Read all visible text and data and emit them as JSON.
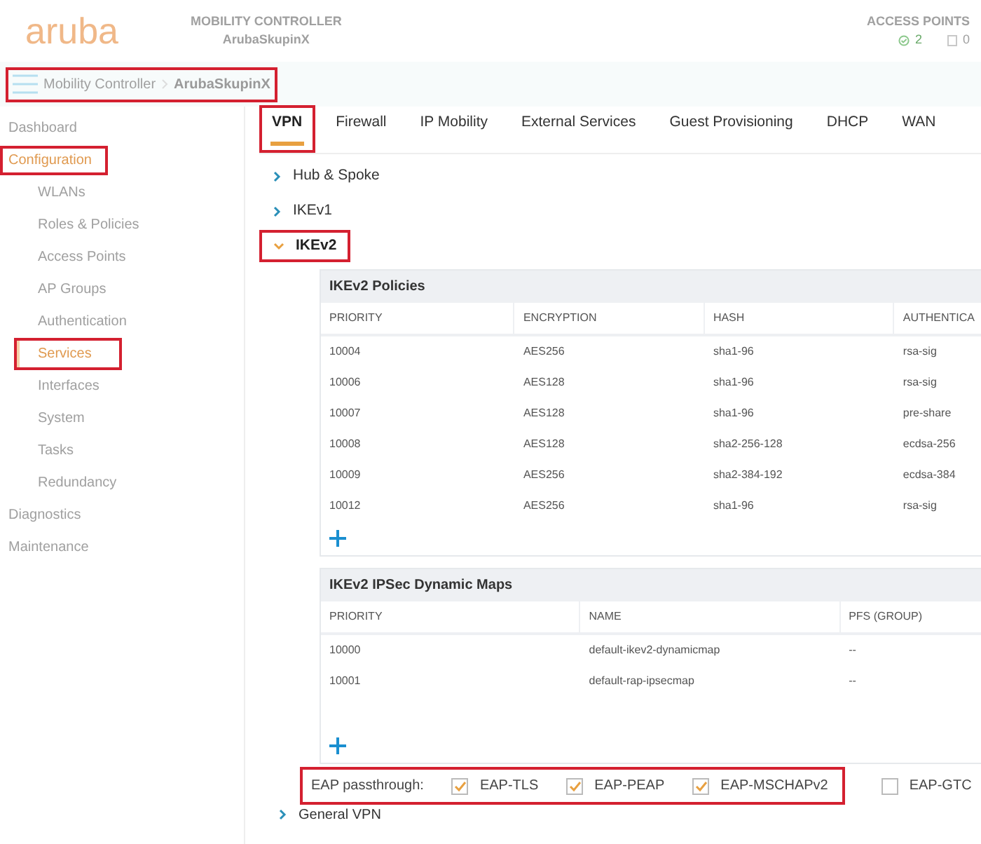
{
  "header": {
    "logo": "aruba",
    "controller_label": "MOBILITY CONTROLLER",
    "controller_name": "ArubaSkupinX",
    "access_points_label": "ACCESS POINTS",
    "ap_up": "2",
    "ap_down": "0"
  },
  "breadcrumb": {
    "items": [
      "Mobility Controller",
      "ArubaSkupinX"
    ],
    "annotated": true
  },
  "sidebar": {
    "items": [
      {
        "label": "Dashboard",
        "selected": false,
        "annotated": false
      },
      {
        "label": "Configuration",
        "selected": true,
        "annotated": true,
        "children": [
          {
            "label": "WLANs",
            "selected": false,
            "annotated": false
          },
          {
            "label": "Roles & Policies",
            "selected": false,
            "annotated": false
          },
          {
            "label": "Access Points",
            "selected": false,
            "annotated": false
          },
          {
            "label": "AP Groups",
            "selected": false,
            "annotated": false
          },
          {
            "label": "Authentication",
            "selected": false,
            "annotated": false
          },
          {
            "label": "Services",
            "selected": true,
            "annotated": true
          },
          {
            "label": "Interfaces",
            "selected": false,
            "annotated": false
          },
          {
            "label": "System",
            "selected": false,
            "annotated": false
          },
          {
            "label": "Tasks",
            "selected": false,
            "annotated": false
          },
          {
            "label": "Redundancy",
            "selected": false,
            "annotated": false
          }
        ]
      },
      {
        "label": "Diagnostics",
        "selected": false,
        "annotated": false
      },
      {
        "label": "Maintenance",
        "selected": false,
        "annotated": false
      }
    ]
  },
  "tabs": [
    {
      "label": "VPN",
      "selected": true,
      "annotated": true
    },
    {
      "label": "Firewall",
      "selected": false,
      "annotated": false
    },
    {
      "label": "IP Mobility",
      "selected": false,
      "annotated": false
    },
    {
      "label": "External Services",
      "selected": false,
      "annotated": false
    },
    {
      "label": "Guest Provisioning",
      "selected": false,
      "annotated": false
    },
    {
      "label": "DHCP",
      "selected": false,
      "annotated": false
    },
    {
      "label": "WAN",
      "selected": false,
      "annotated": false
    }
  ],
  "sections": [
    {
      "label": "Hub & Spoke",
      "expanded": false,
      "annotated": false
    },
    {
      "label": "IKEv1",
      "expanded": false,
      "annotated": false
    },
    {
      "label": "IKEv2",
      "expanded": true,
      "annotated": true
    }
  ],
  "policies_table": {
    "title": "IKEv2 Policies",
    "columns": [
      "PRIORITY",
      "ENCRYPTION",
      "HASH",
      "AUTHENTICA"
    ],
    "rows": [
      [
        "10004",
        "AES256",
        "sha1-96",
        "rsa-sig"
      ],
      [
        "10006",
        "AES128",
        "sha1-96",
        "rsa-sig"
      ],
      [
        "10007",
        "AES128",
        "sha1-96",
        "pre-share"
      ],
      [
        "10008",
        "AES128",
        "sha2-256-128",
        "ecdsa-256"
      ],
      [
        "10009",
        "AES256",
        "sha2-384-192",
        "ecdsa-384"
      ],
      [
        "10012",
        "AES256",
        "sha1-96",
        "rsa-sig"
      ]
    ]
  },
  "dynamic_maps_table": {
    "title": "IKEv2 IPSec Dynamic Maps",
    "columns": [
      "PRIORITY",
      "NAME",
      "PFS (GROUP)"
    ],
    "rows": [
      [
        "10000",
        "default-ikev2-dynamicmap",
        "--"
      ],
      [
        "10001",
        "default-rap-ipsecmap",
        "--"
      ]
    ]
  },
  "eap_passthrough": {
    "label": "EAP passthrough:",
    "annotated": true,
    "options": [
      {
        "label": "EAP-TLS",
        "checked": true,
        "annotated": true
      },
      {
        "label": "EAP-PEAP",
        "checked": true,
        "annotated": true
      },
      {
        "label": "EAP-MSCHAPv2",
        "checked": true,
        "annotated": true
      },
      {
        "label": "EAP-GTC",
        "checked": false,
        "annotated": false
      }
    ]
  },
  "sections_after": [
    {
      "label": "General VPN",
      "expanded": false
    }
  ]
}
